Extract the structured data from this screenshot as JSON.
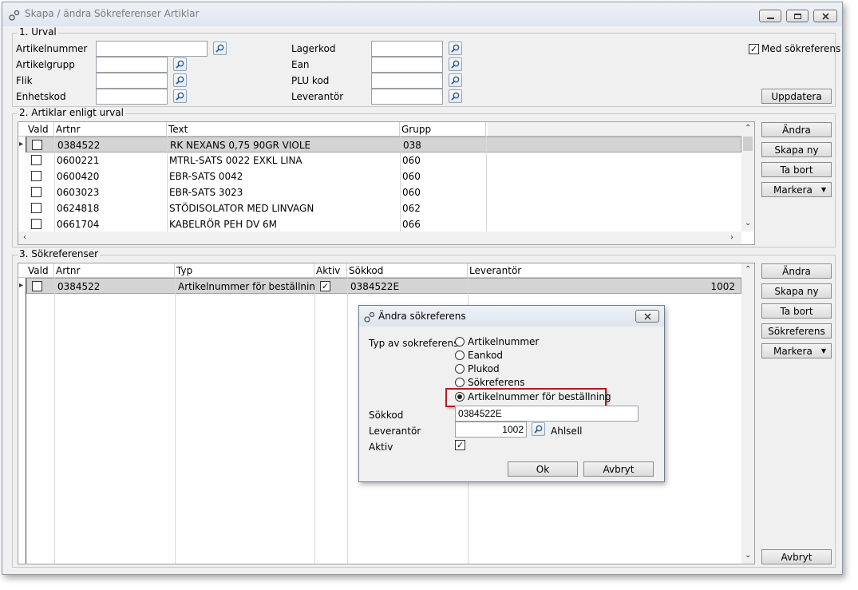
{
  "window": {
    "title": "Skapa / ändra Sökreferenser Artiklar"
  },
  "urval": {
    "title": "1. Urval",
    "fields": {
      "artikelnummer": {
        "label": "Artikelnummer",
        "value": ""
      },
      "artikelgrupp": {
        "label": "Artikelgrupp",
        "value": ""
      },
      "flik": {
        "label": "Flik",
        "value": ""
      },
      "enhetskod": {
        "label": "Enhetskod",
        "value": ""
      },
      "lagerkod": {
        "label": "Lagerkod",
        "value": ""
      },
      "ean": {
        "label": "Ean",
        "value": ""
      },
      "plu_kod": {
        "label": "PLU kod",
        "value": ""
      },
      "leverantor": {
        "label": "Leverantör",
        "value": ""
      }
    },
    "med_sokreferens": {
      "label": "Med sökreferens",
      "checked": true
    },
    "uppdatera_label": "Uppdatera"
  },
  "artiklar": {
    "title": "2. Artiklar enligt urval",
    "columns": [
      "Vald",
      "Artnr",
      "Text",
      "Grupp"
    ],
    "rows": [
      {
        "artnr": "0384522",
        "text": "RK NEXANS 0,75 90GR VIOLE",
        "grupp": "038"
      },
      {
        "artnr": "0600221",
        "text": "MTRL-SATS 0022 EXKL LINA",
        "grupp": "060"
      },
      {
        "artnr": "0600420",
        "text": "EBR-SATS 0042",
        "grupp": "060"
      },
      {
        "artnr": "0603023",
        "text": "EBR-SATS 3023",
        "grupp": "060"
      },
      {
        "artnr": "0624818",
        "text": "STÖDISOLATOR MED LINVAGN",
        "grupp": "062"
      },
      {
        "artnr": "0661704",
        "text": "KABELRÖR PEH DV 6M",
        "grupp": "066"
      }
    ],
    "buttons": {
      "andra": "Ändra",
      "skapa_ny": "Skapa ny",
      "ta_bort": "Ta bort",
      "markera": "Markera"
    }
  },
  "sokreferenser": {
    "title": "3. Sökreferenser",
    "columns": [
      "Vald",
      "Artnr",
      "Typ",
      "Aktiv",
      "Sökkod",
      "Leverantör"
    ],
    "rows": [
      {
        "artnr": "0384522",
        "typ": "Artikelnummer för beställning",
        "aktiv": true,
        "sokkod": "0384522E",
        "leverantor": "1002"
      }
    ],
    "buttons": {
      "andra": "Ändra",
      "skapa_ny": "Skapa ny",
      "ta_bort": "Ta bort",
      "sokreferens": "Sökreferens",
      "markera": "Markera",
      "avbryt": "Avbryt"
    }
  },
  "dialog": {
    "title": "Ändra sökreferens",
    "typ_label": "Typ av sokreferens",
    "options": [
      "Artikelnummer",
      "Eankod",
      "Plukod",
      "Sökreferens",
      "Artikelnummer för beställning"
    ],
    "selected_index": 4,
    "sokkod": {
      "label": "Sökkod",
      "value": "0384522E"
    },
    "leverantor": {
      "label": "Leverantör",
      "value": "1002",
      "name": "Ahlsell"
    },
    "aktiv": {
      "label": "Aktiv",
      "checked": true
    },
    "ok_label": "Ok",
    "avbryt_label": "Avbryt",
    "highlight_color": "#b51c1c"
  }
}
